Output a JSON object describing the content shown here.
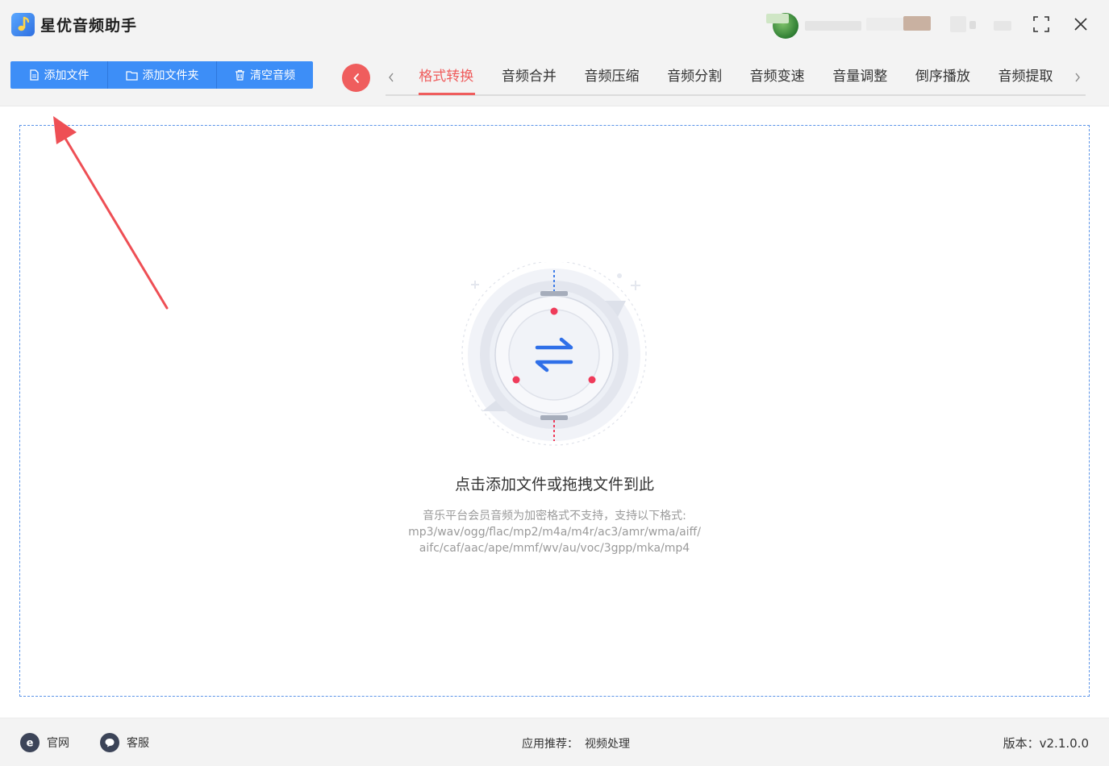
{
  "window": {
    "title": "星优音频助手",
    "maximize_icon": "maximize-icon",
    "close_icon": "close-icon"
  },
  "toolbar": {
    "add_file_label": "添加文件",
    "add_folder_label": "添加文件夹",
    "clear_label": "清空音频",
    "accent_color": "#3d8ef7"
  },
  "tabs": {
    "active_color": "#ef5d5d",
    "items": [
      {
        "label": "格式转换",
        "active": true
      },
      {
        "label": "音频合并",
        "active": false
      },
      {
        "label": "音频压缩",
        "active": false
      },
      {
        "label": "音频分割",
        "active": false
      },
      {
        "label": "音频变速",
        "active": false
      },
      {
        "label": "音量调整",
        "active": false
      },
      {
        "label": "倒序播放",
        "active": false
      },
      {
        "label": "音频提取",
        "active": false
      }
    ]
  },
  "dropzone": {
    "title": "点击添加文件或拖拽文件到此",
    "note_line1": "音乐平台会员音频为加密格式不支持，支持以下格式:",
    "note_line2": "mp3/wav/ogg/flac/mp2/m4a/m4r/ac3/amr/wma/aiff/",
    "note_line3": "aifc/caf/aac/ape/mmf/wv/au/voc/3gpp/mka/mp4"
  },
  "footer": {
    "website_label": "官网",
    "support_label": "客服",
    "recommend_label": "应用推荐：",
    "recommend_link": "视频处理",
    "version": "版本：v2.1.0.0"
  }
}
